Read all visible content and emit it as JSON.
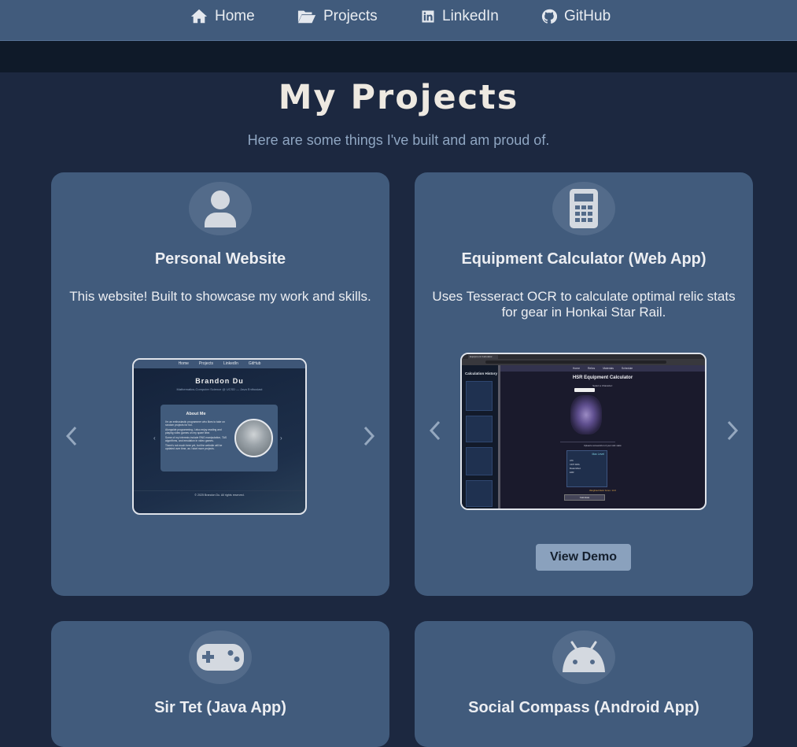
{
  "nav": {
    "items": [
      {
        "label": "Home",
        "icon": "home-icon"
      },
      {
        "label": "Projects",
        "icon": "folder-open-icon"
      },
      {
        "label": "LinkedIn",
        "icon": "linkedin-icon"
      },
      {
        "label": "GitHub",
        "icon": "github-icon"
      }
    ]
  },
  "page": {
    "title": "My Projects",
    "subtitle": "Here are some things I've built and am proud of."
  },
  "colors": {
    "background": "#1c2840",
    "card": "#415b7c",
    "navbar": "#415b7c",
    "title": "#eee9e1",
    "subtitle": "#8fa6c2",
    "button": "#8aa1bd"
  },
  "projects": [
    {
      "title": "Personal Website",
      "description": "This website! Built to showcase my work and skills.",
      "icon": "user-icon",
      "preview": {
        "nav": [
          "Home",
          "Projects",
          "LinkedIn",
          "GitHub"
        ],
        "name": "Brandon Du",
        "tagline": "Mathematics-Computer Science @ UCSD — Java Enthusiast",
        "about_heading": "About Me",
        "about_p1": "I'm an enthusiastic programmer who likes to take on random projects for fun.",
        "about_p2": "Alongside programming, I also enjoy reading and playing video games on my spare time.",
        "about_p3": "Some of my interests include RNG manipulation, TAS algorithms, and emulation in video games.",
        "about_p4": "There's not much here yet, but the website will be updated over time, as I start more projects.",
        "footer": "© 2025 Brandon Du. All rights reserved."
      }
    },
    {
      "title": "Equipment Calculator (Web App)",
      "description": "Uses Tesseract OCR to calculate optimal relic stats for gear in Honkai Star Rail.",
      "icon": "calculator-icon",
      "button": "View Demo",
      "preview": {
        "tab_title": "Equipment Calculator",
        "app_nav": [
          "Home",
          "Relics",
          "Materials",
          "Schedule"
        ],
        "history_heading": "Calculation History",
        "heading": "HSR Equipment Calculator",
        "select_label": "Select a Character:",
        "upload_label": "Upload a screenshot of your relic stats:",
        "max_level": "Max Level",
        "stats": [
          "ATK",
          "CRIT DMG",
          "Break Effect",
          "ERR"
        ],
        "weighted": "Weighted Relic Score: 14.6",
        "calc_button": "Calculate"
      }
    },
    {
      "title": "Sir Tet (Java App)",
      "icon": "gamepad-icon"
    },
    {
      "title": "Social Compass (Android App)",
      "icon": "android-icon"
    }
  ]
}
